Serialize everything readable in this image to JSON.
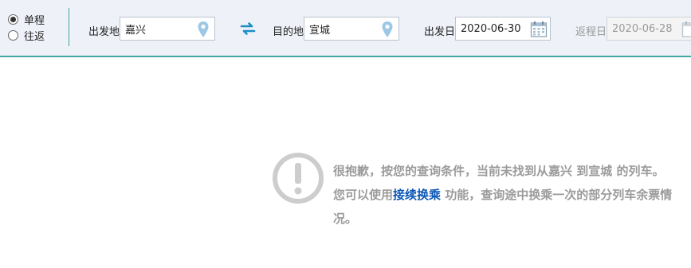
{
  "trip_type": {
    "options": [
      {
        "label": "单程",
        "selected": true
      },
      {
        "label": "往返",
        "selected": false
      }
    ]
  },
  "search": {
    "from_label": "出发地",
    "from_value": "嘉兴",
    "to_label": "目的地",
    "to_value": "宣城",
    "depart_label": "出发日",
    "depart_value": "2020-06-30",
    "return_label": "返程日",
    "return_value": "2020-06-28"
  },
  "icons": {
    "location": "location-pin-icon",
    "swap": "swap-arrows-icon",
    "calendar": "calendar-icon",
    "warning": "exclamation-circle-icon"
  },
  "colors": {
    "topbar_bg": "#eef1f8",
    "accent_teal": "#45a8a0",
    "swap_blue": "#1a8fc4",
    "link_blue": "#0a57b5",
    "message_gray": "#9b9b9b"
  },
  "message": {
    "part1": "很抱歉，按您的查询条件，当前未找到从嘉兴 到宣城 的列车。您可以使用",
    "link": "接续换乘",
    "part2": " 功能，查询途中换乘一次的部分列车余票情况。"
  }
}
